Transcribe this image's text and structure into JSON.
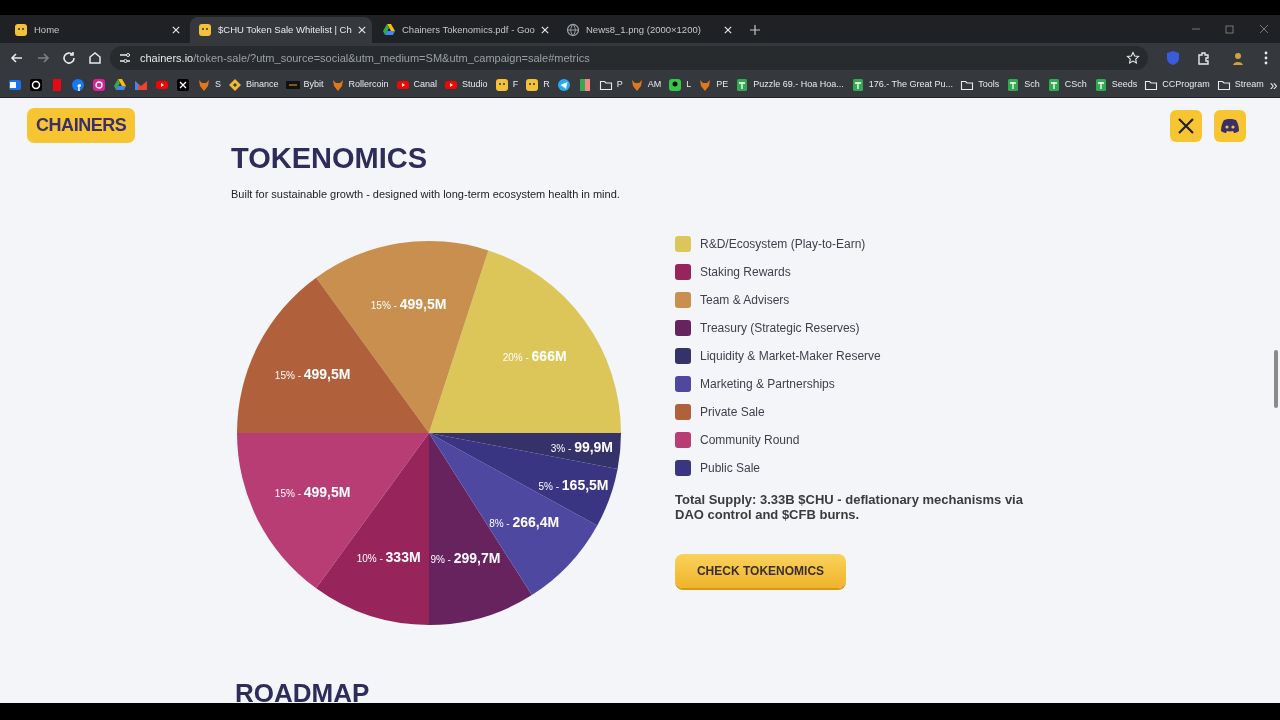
{
  "browser": {
    "tabs": [
      {
        "title": "Home",
        "selected": false
      },
      {
        "title": "$CHU Token Sale Whitelist | Ch",
        "selected": true
      },
      {
        "title": "Chainers Tokenomics.pdf - Goo",
        "selected": false
      },
      {
        "title": "News8_1.png (2000×1200)",
        "selected": false
      }
    ],
    "url": {
      "host": "chainers.io",
      "path": "/token-sale/?utm_source=social&utm_medium=SM&utm_campaign=sale#metrics"
    },
    "bookmarks": [
      {
        "kind": "icon"
      },
      {
        "kind": "icon"
      },
      {
        "kind": "icon"
      },
      {
        "kind": "icon"
      },
      {
        "kind": "icon"
      },
      {
        "kind": "icon"
      },
      {
        "kind": "icon"
      },
      {
        "kind": "icon"
      },
      {
        "kind": "icon"
      },
      {
        "kind": "link",
        "label": "S"
      },
      {
        "kind": "link",
        "label": "Binance"
      },
      {
        "kind": "link",
        "label": "Bybit"
      },
      {
        "kind": "link",
        "label": "Rollercoin"
      },
      {
        "kind": "link",
        "label": "Canal"
      },
      {
        "kind": "link",
        "label": "Studio"
      },
      {
        "kind": "link",
        "label": "F"
      },
      {
        "kind": "link",
        "label": "R"
      },
      {
        "kind": "icon"
      },
      {
        "kind": "icon"
      },
      {
        "kind": "link",
        "label": "P"
      },
      {
        "kind": "link",
        "label": "AM"
      },
      {
        "kind": "link",
        "label": "L"
      },
      {
        "kind": "link",
        "label": "PE"
      },
      {
        "kind": "link",
        "label": "Puzzle 69.- Hoa Hoa..."
      },
      {
        "kind": "link",
        "label": "176.- The Great Pu..."
      },
      {
        "kind": "link",
        "label": "Tools"
      },
      {
        "kind": "link",
        "label": "Sch"
      },
      {
        "kind": "link",
        "label": "CSch"
      },
      {
        "kind": "link",
        "label": "Seeds"
      },
      {
        "kind": "link",
        "label": "CCProgram"
      },
      {
        "kind": "link",
        "label": "Stream"
      }
    ],
    "more": "»"
  },
  "header": {
    "logo": "CHAINERS"
  },
  "section": {
    "title": "TOKENOMICS",
    "subtitle": "Built for sustainable growth - designed with long-term ecosystem health in mind.",
    "legend": [
      {
        "label": "R&D/Ecosystem (Play-to-Earn)",
        "color": "#dcc65a"
      },
      {
        "label": "Staking Rewards",
        "color": "#97245a"
      },
      {
        "label": "Team & Advisers",
        "color": "#c98f4e"
      },
      {
        "label": "Treasury (Strategic Reserves)",
        "color": "#67235e"
      },
      {
        "label": "Liquidity & Market-Maker Reserve",
        "color": "#35326a"
      },
      {
        "label": "Marketing & Partnerships",
        "color": "#4f48a0"
      },
      {
        "label": "Private Sale",
        "color": "#b0603a"
      },
      {
        "label": "Community Round",
        "color": "#b83d74"
      },
      {
        "label": "Public Sale",
        "color": "#3a3582"
      }
    ],
    "total": "Total Supply: 3.33B $CHU - deflationary mechanisms via DAO control and $CFB burns.",
    "button": "CHECK TOKENOMICS",
    "chart_data": {
      "type": "pie",
      "values": [
        20,
        15,
        15,
        15,
        10,
        9,
        8,
        5,
        3
      ],
      "colors": [
        "#dcc65a",
        "#c98f4e",
        "#b0603a",
        "#b83d74",
        "#97245a",
        "#67235e",
        "#4f48a0",
        "#3a3582",
        "#35326a"
      ],
      "value_labels": [
        "20% - 666M",
        "15% - 499,5M",
        "15% - 499,5M",
        "15% - 499,5M",
        "10% - 333M",
        "9% - 299,7M",
        "8% - 266,4M",
        "5% - 165,5M",
        "3% - 99,9M"
      ]
    }
  },
  "next_section": {
    "title": "ROADMAP"
  }
}
